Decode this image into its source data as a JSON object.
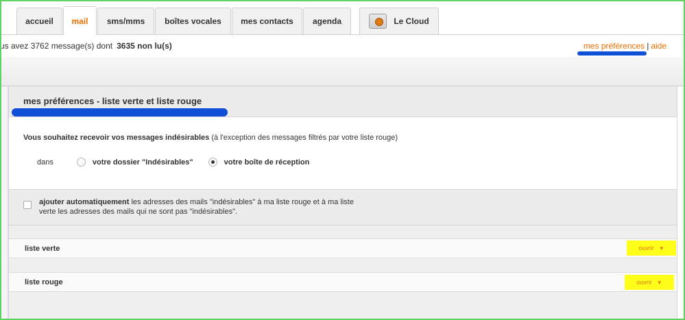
{
  "tabs": [
    {
      "label": "accueil"
    },
    {
      "label": "mail"
    },
    {
      "label": "sms/mms"
    },
    {
      "label": "boîtes vocales"
    },
    {
      "label": "mes contacts"
    },
    {
      "label": "agenda"
    },
    {
      "label": "Le Cloud"
    }
  ],
  "infobar": {
    "message_count": "us avez 3762 message(s) dont",
    "unread": "3635 non lu(s)",
    "link_preferences": "mes préférences",
    "separator": "|",
    "link_help": "aide"
  },
  "section": {
    "title": "mes préférences - liste verte et liste rouge",
    "question_bold": "Vous souhaitez recevoir vos messages indésirables",
    "question_rest": " (à l'exception des messages filtrés par votre liste rouge)",
    "dans": "dans",
    "option_1": "votre dossier \"Indésirables\"",
    "option_2": "votre boîte de réception",
    "selected_option": 2
  },
  "auto_add": {
    "bold": "ajouter automatiquement",
    "text": " les adresses des mails \"indésirables\" à ma liste rouge et à ma liste verte les adresses des mails qui ne sont pas \"indésirables\".",
    "checked": false
  },
  "lists": [
    {
      "label": "liste verte",
      "action": "ouvrir"
    },
    {
      "label": "liste rouge",
      "action": "ouvrir"
    }
  ],
  "colors": {
    "accent": "#f16e00",
    "highlight": "#ffff1a",
    "annotation": "#1050d8",
    "frame": "#5fd35f"
  }
}
